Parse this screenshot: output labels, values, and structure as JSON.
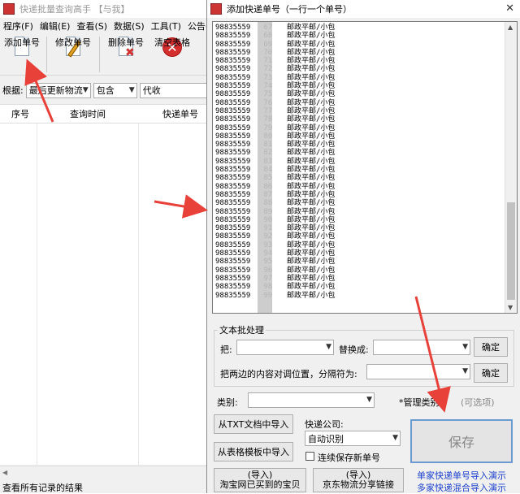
{
  "main_window": {
    "title": "快递批量查询高手 【与我】",
    "menu": [
      "程序(F)",
      "编辑(E)",
      "查看(S)",
      "数据(S)",
      "工具(T)",
      "公告(X)"
    ],
    "toolbar": {
      "add_label": "添加单号",
      "edit_label": "修改单号",
      "delete_label": "删除单号",
      "clear_label": "清空表格"
    },
    "filter": {
      "label": "根据:",
      "field": "最后更新物流",
      "op": "包含",
      "value": "代收"
    },
    "columns": [
      "序号",
      "查询时间",
      "快递单号"
    ],
    "status": "查看所有记录的结果"
  },
  "dialog": {
    "title": "添加快递单号（一行一个单号）",
    "lines": [
      {
        "prefix": "98835559",
        "suffix": "67",
        "carrier": "邮政平邮/小包"
      },
      {
        "prefix": "98835559",
        "suffix": "68",
        "carrier": "邮政平邮/小包"
      },
      {
        "prefix": "98835559",
        "suffix": "69",
        "carrier": "邮政平邮/小包"
      },
      {
        "prefix": "98835559",
        "suffix": "70",
        "carrier": "邮政平邮/小包"
      },
      {
        "prefix": "98835559",
        "suffix": "71",
        "carrier": "邮政平邮/小包"
      },
      {
        "prefix": "98835559",
        "suffix": "72",
        "carrier": "邮政平邮/小包"
      },
      {
        "prefix": "98835559",
        "suffix": "73",
        "carrier": "邮政平邮/小包"
      },
      {
        "prefix": "98835559",
        "suffix": "74",
        "carrier": "邮政平邮/小包"
      },
      {
        "prefix": "98835559",
        "suffix": "75",
        "carrier": "邮政平邮/小包"
      },
      {
        "prefix": "98835559",
        "suffix": "76",
        "carrier": "邮政平邮/小包"
      },
      {
        "prefix": "98835559",
        "suffix": "77",
        "carrier": "邮政平邮/小包"
      },
      {
        "prefix": "98835559",
        "suffix": "78",
        "carrier": "邮政平邮/小包"
      },
      {
        "prefix": "98835559",
        "suffix": "79",
        "carrier": "邮政平邮/小包"
      },
      {
        "prefix": "98835559",
        "suffix": "80",
        "carrier": "邮政平邮/小包"
      },
      {
        "prefix": "98835559",
        "suffix": "81",
        "carrier": "邮政平邮/小包"
      },
      {
        "prefix": "98835559",
        "suffix": "82",
        "carrier": "邮政平邮/小包"
      },
      {
        "prefix": "98835559",
        "suffix": "83",
        "carrier": "邮政平邮/小包"
      },
      {
        "prefix": "98835559",
        "suffix": "84",
        "carrier": "邮政平邮/小包"
      },
      {
        "prefix": "98835559",
        "suffix": "85",
        "carrier": "邮政平邮/小包"
      },
      {
        "prefix": "98835559",
        "suffix": "86",
        "carrier": "邮政平邮/小包"
      },
      {
        "prefix": "98835559",
        "suffix": "87",
        "carrier": "邮政平邮/小包"
      },
      {
        "prefix": "98835559",
        "suffix": "88",
        "carrier": "邮政平邮/小包"
      },
      {
        "prefix": "98835559",
        "suffix": "89",
        "carrier": "邮政平邮/小包"
      },
      {
        "prefix": "98835559",
        "suffix": "90",
        "carrier": "邮政平邮/小包"
      },
      {
        "prefix": "98835559",
        "suffix": "91",
        "carrier": "邮政平邮/小包"
      },
      {
        "prefix": "98835559",
        "suffix": "92",
        "carrier": "邮政平邮/小包"
      },
      {
        "prefix": "98835559",
        "suffix": "93",
        "carrier": "邮政平邮/小包"
      },
      {
        "prefix": "98835559",
        "suffix": "94",
        "carrier": "邮政平邮/小包"
      },
      {
        "prefix": "98835559",
        "suffix": "95",
        "carrier": "邮政平邮/小包"
      },
      {
        "prefix": "98835559",
        "suffix": "96",
        "carrier": "邮政平邮/小包"
      },
      {
        "prefix": "98835559",
        "suffix": "97",
        "carrier": "邮政平邮/小包"
      },
      {
        "prefix": "98835559",
        "suffix": "98",
        "carrier": "邮政平邮/小包"
      },
      {
        "prefix": "98835559",
        "suffix": "99",
        "carrier": "邮政平邮/小包"
      }
    ],
    "batch": {
      "legend": "文本批处理",
      "replace_from_label": "把:",
      "replace_to_label": "替换成:",
      "confirm_label": "确定",
      "swap_label": "把两边的内容对调位置，分隔符为:",
      "confirm2_label": "确定"
    },
    "category_label": "类别:",
    "manage_category_label": "*管理类别",
    "optional_hint": "(可选项)",
    "import_txt_label": "从TXT文档中导入",
    "import_table_label": "从表格模板中导入",
    "courier_label": "快递公司:",
    "courier_value": "自动识别",
    "keep_saving_label": "连续保存新单号",
    "save_label": "保存",
    "import_taobao_top": "(导入)",
    "import_taobao_bottom": "淘宝网已买到的宝贝",
    "import_jd_top": "(导入)",
    "import_jd_bottom": "京东物流分享链接",
    "demo_single": "单家快递单号导入演示",
    "demo_mixed": "多家快递混合导入演示"
  }
}
